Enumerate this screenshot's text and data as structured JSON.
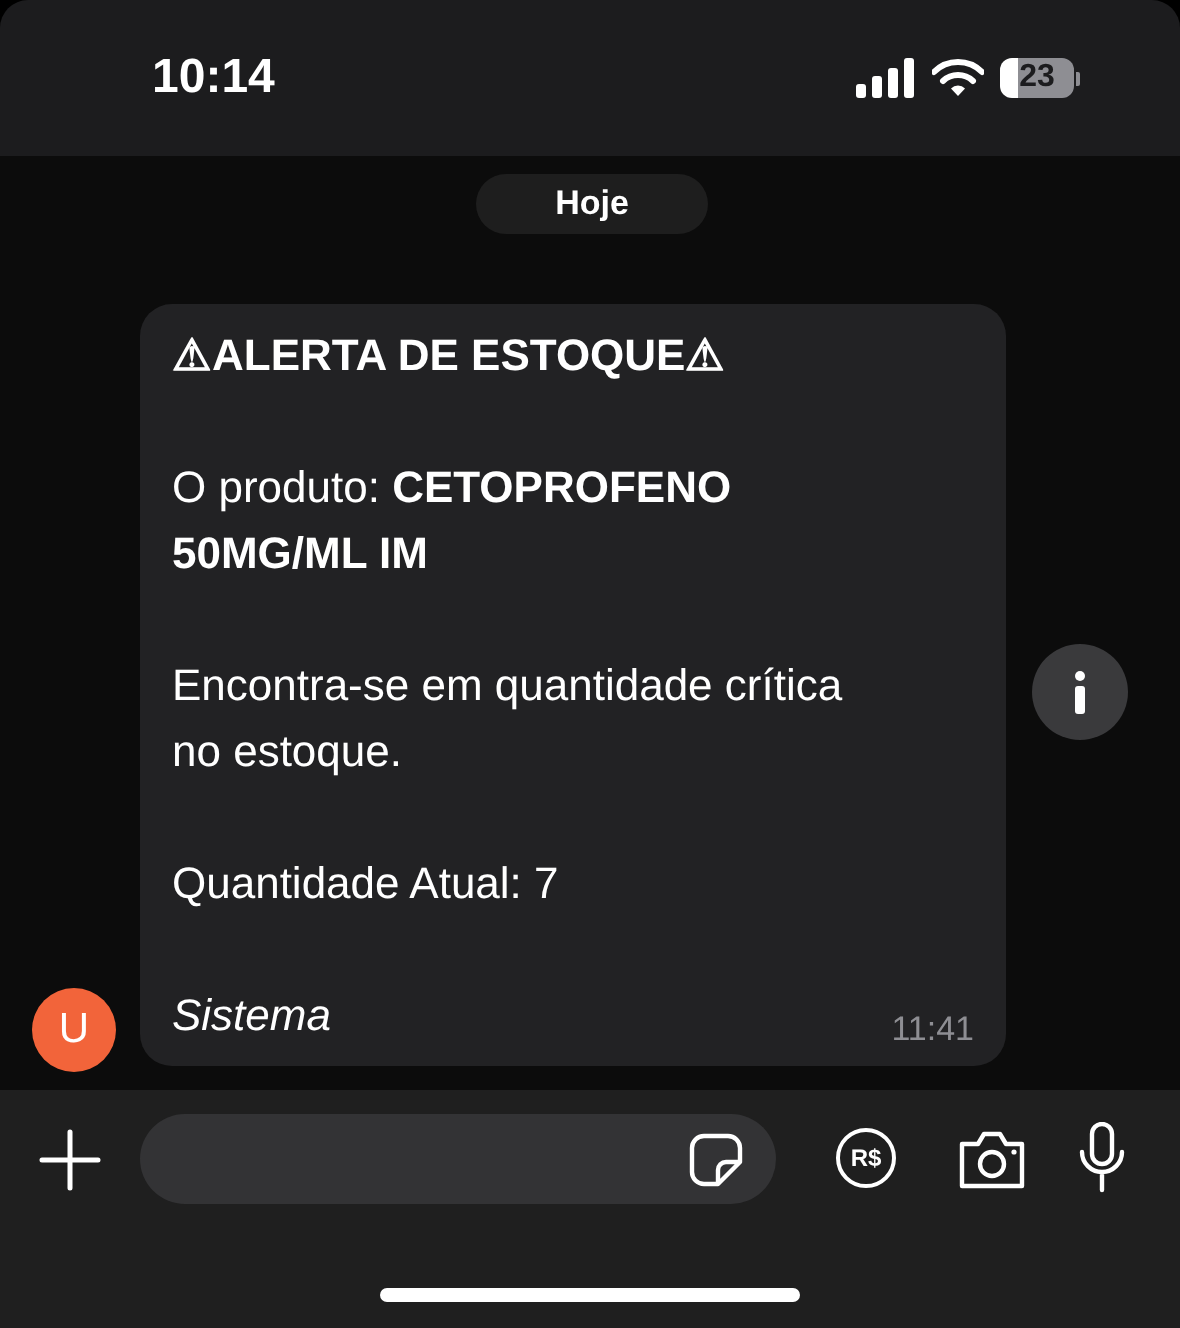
{
  "status_bar": {
    "time": "10:14",
    "battery": "23"
  },
  "date_chip": "Hoje",
  "message": {
    "title": "⚠ALERTA DE ESTOQUE⚠",
    "paragraphs": [
      "O produto: **CETOPROFENO 50MG/ML IM**",
      "Encontra-se em quantidade crítica no estoque.",
      "Quantidade Atual: 7"
    ],
    "signature": "Sistema",
    "time": "11:41",
    "avatar": "U"
  },
  "composer": {
    "payment_label": "R$"
  }
}
